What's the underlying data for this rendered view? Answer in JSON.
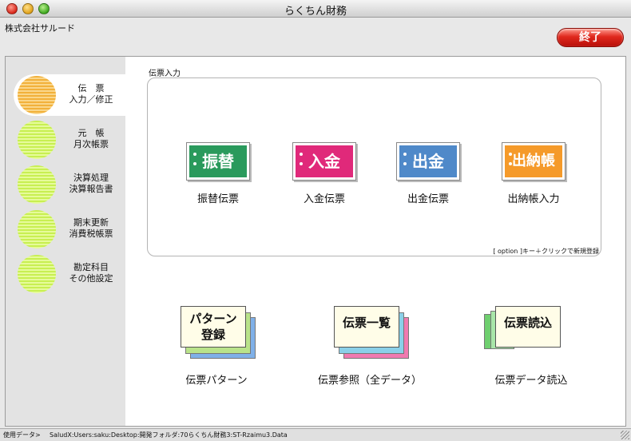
{
  "window": {
    "title": "らくちん財務"
  },
  "header": {
    "company": "株式会社サルード",
    "quit_label": "終了"
  },
  "sidebar": {
    "items": [
      {
        "line1": "伝　票",
        "line2": "入力／修正",
        "active": true
      },
      {
        "line1": "元　帳",
        "line2": "月次帳票",
        "active": false
      },
      {
        "line1": "決算処理",
        "line2": "決算報告書",
        "active": false
      },
      {
        "line1": "期末更新",
        "line2": "消費税帳票",
        "active": false
      },
      {
        "line1": "勘定科目",
        "line2": "その他設定",
        "active": false
      }
    ]
  },
  "voucher_group": {
    "title": "伝票入力",
    "buttons": [
      {
        "icon_text": "振替",
        "label": "振替伝票",
        "color": "#2a9a5c",
        "icon": "transfer-voucher-icon"
      },
      {
        "icon_text": "入金",
        "label": "入金伝票",
        "color": "#e0297a",
        "icon": "deposit-voucher-icon"
      },
      {
        "icon_text": "出金",
        "label": "出金伝票",
        "color": "#4f89c9",
        "icon": "withdrawal-voucher-icon"
      },
      {
        "icon_text": "出納帳",
        "label": "出納帳入力",
        "color": "#f59a2a",
        "icon": "cashbook-icon"
      }
    ],
    "note": "[ option ]キー＋クリックで新規登録"
  },
  "bottom_buttons": [
    {
      "icon_line1": "パターン",
      "icon_line2": "登録",
      "label": "伝票パターン",
      "icon": "pattern-register-icon"
    },
    {
      "icon_line1": "伝票一覧",
      "icon_line2": "",
      "label": "伝票参照（全データ）",
      "icon": "voucher-list-icon"
    },
    {
      "icon_line1": "伝票読込",
      "icon_line2": "",
      "label": "伝票データ読込",
      "icon": "voucher-import-icon"
    }
  ],
  "status": {
    "label": "使用データ>",
    "path": "SaludX:Users:saku:Desktop:開発フォルダ:70らくちん財務3:ST-Rzaimu3.Data"
  }
}
